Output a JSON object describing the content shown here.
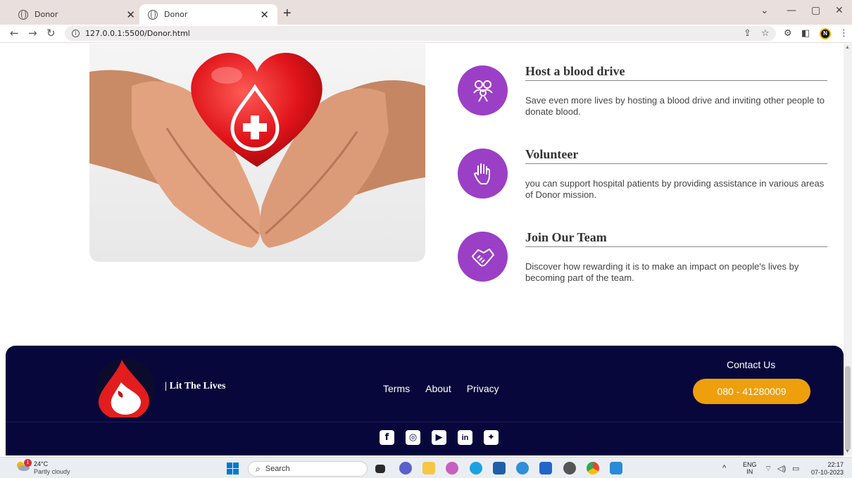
{
  "browser": {
    "tabs": [
      {
        "title": "Donor",
        "active": false
      },
      {
        "title": "Donor",
        "active": true
      }
    ],
    "new_tab_icon": "plus-icon",
    "url": "127.0.0.1:5500/Donor.html",
    "profile_initial": "N"
  },
  "features": [
    {
      "title": "Host a blood drive",
      "description": "Save even more lives by hosting a blood drive and inviting other people to donate blood.",
      "icon": "group-icon"
    },
    {
      "title": "Volunteer",
      "description": "you can support hospital patients by providing assistance in various areas of Donor mission.",
      "icon": "hand-icon"
    },
    {
      "title": "Join Our Team",
      "description": "Discover how rewarding it is to make an impact on people's lives by becoming part of the team.",
      "icon": "handshake-icon"
    }
  ],
  "footer": {
    "brand": "| Lit The Lives",
    "links": [
      "Terms",
      "About",
      "Privacy"
    ],
    "contact_title": "Contact Us",
    "phone": "080 - 41280009",
    "socials": [
      "facebook-icon",
      "instagram-icon",
      "youtube-icon",
      "linkedin-icon",
      "twitter-icon"
    ]
  },
  "taskbar": {
    "weather_temp": "24°C",
    "weather_desc": "Partly cloudy",
    "weather_badge": "1",
    "search_placeholder": "Search",
    "lang_top": "ENG",
    "lang_bottom": "IN",
    "time": "22:17",
    "date": "07-10-2023"
  },
  "colors": {
    "accent_purple": "#9b3fc7",
    "footer_navy": "#08073b",
    "phone_orange": "#ee9f0c"
  }
}
